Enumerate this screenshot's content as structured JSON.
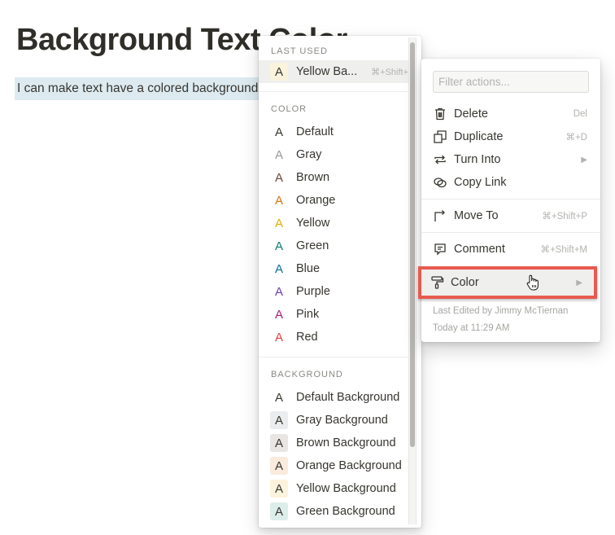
{
  "page": {
    "title": "Background Text Color",
    "highlighted_text": "I can make text have a colored background",
    "highlight_color": "#ddebf1"
  },
  "color_menu": {
    "last_used": {
      "label": "LAST USED",
      "item": {
        "label": "Yellow Ba...",
        "shortcut": "⌘+Shift+",
        "text_color": "#37352f",
        "bg_color": "#fbf3db"
      }
    },
    "color_section": {
      "label": "COLOR",
      "items": [
        {
          "label": "Default",
          "text_color": "#37352f"
        },
        {
          "label": "Gray",
          "text_color": "#9b9a97"
        },
        {
          "label": "Brown",
          "text_color": "#64473a"
        },
        {
          "label": "Orange",
          "text_color": "#d9730d"
        },
        {
          "label": "Yellow",
          "text_color": "#dfab01"
        },
        {
          "label": "Green",
          "text_color": "#0f7b6c"
        },
        {
          "label": "Blue",
          "text_color": "#0b6e99"
        },
        {
          "label": "Purple",
          "text_color": "#6940a5"
        },
        {
          "label": "Pink",
          "text_color": "#ad1a72"
        },
        {
          "label": "Red",
          "text_color": "#e03e3e"
        }
      ]
    },
    "background_section": {
      "label": "BACKGROUND",
      "items": [
        {
          "label": "Default Background",
          "bg_color": "#ffffff"
        },
        {
          "label": "Gray Background",
          "bg_color": "#ebeced"
        },
        {
          "label": "Brown Background",
          "bg_color": "#e9e5e3"
        },
        {
          "label": "Orange Background",
          "bg_color": "#faebdd"
        },
        {
          "label": "Yellow Background",
          "bg_color": "#fbf3db"
        },
        {
          "label": "Green Background",
          "bg_color": "#ddedea"
        }
      ]
    },
    "glyph": "A"
  },
  "actions_menu": {
    "filter_placeholder": "Filter actions...",
    "filter_value": "",
    "items": [
      {
        "label": "Delete",
        "icon": "trash-icon",
        "shortcut": "Del"
      },
      {
        "label": "Duplicate",
        "icon": "duplicate-icon",
        "shortcut": "⌘+D"
      },
      {
        "label": "Turn Into",
        "icon": "turn-into-icon",
        "shortcut": "▶"
      },
      {
        "label": "Copy Link",
        "icon": "link-icon",
        "shortcut": ""
      },
      {
        "label": "Move To",
        "icon": "move-to-icon",
        "shortcut": "⌘+Shift+P"
      },
      {
        "label": "Comment",
        "icon": "comment-icon",
        "shortcut": "⌘+Shift+M"
      },
      {
        "label": "Color",
        "icon": "paint-roller-icon",
        "shortcut": "▶"
      }
    ],
    "last_edited_by": "Last Edited by Jimmy McTiernan",
    "last_edited_time": "Today at 11:29 AM",
    "highlight_border_color": "#e85a4f"
  }
}
